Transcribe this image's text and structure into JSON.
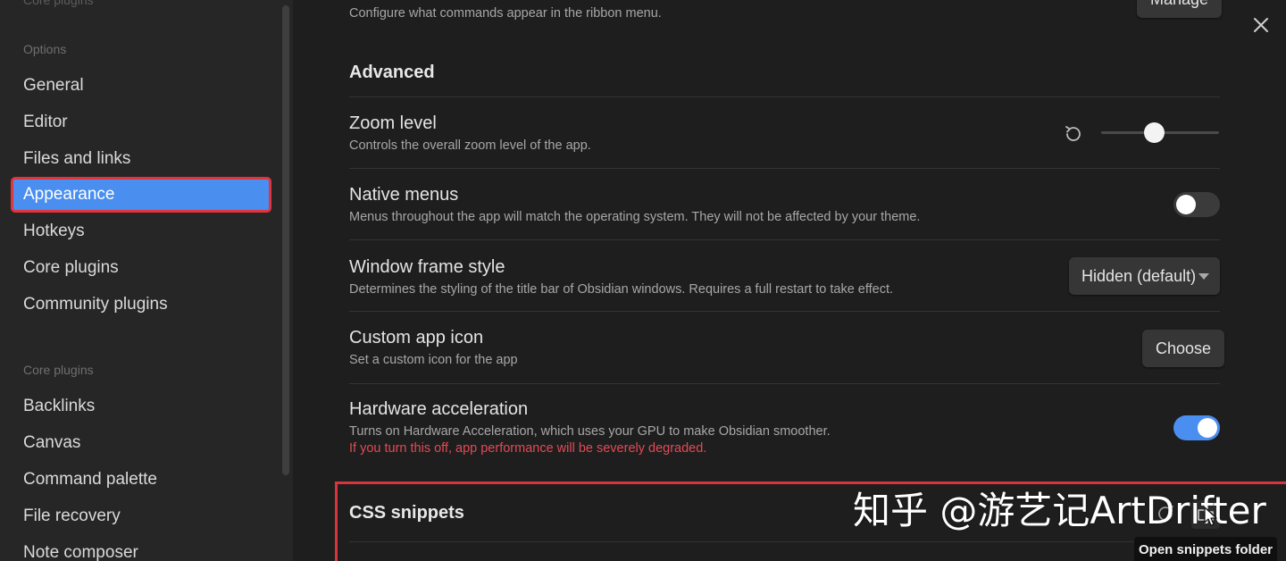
{
  "sidebar": {
    "top_cut_text": "Core plugins",
    "options_heading": "Options",
    "options_items": [
      {
        "label": "General"
      },
      {
        "label": "Editor"
      },
      {
        "label": "Files and links"
      },
      {
        "label": "Appearance"
      },
      {
        "label": "Hotkeys"
      },
      {
        "label": "Core plugins"
      },
      {
        "label": "Community plugins"
      }
    ],
    "core_plugins_heading": "Core plugins",
    "core_plugins_items": [
      {
        "label": "Backlinks"
      },
      {
        "label": "Canvas"
      },
      {
        "label": "Command palette"
      },
      {
        "label": "File recovery"
      },
      {
        "label": "Note composer"
      }
    ],
    "active_item": "Appearance"
  },
  "main": {
    "ribbon": {
      "desc": "Configure what commands appear in the ribbon menu.",
      "button_label": "Manage"
    },
    "advanced_title": "Advanced",
    "zoom": {
      "name": "Zoom level",
      "desc": "Controls the overall zoom level of the app.",
      "value_fraction": 0.45
    },
    "native_menus": {
      "name": "Native menus",
      "desc": "Menus throughout the app will match the operating system. They will not be affected by your theme.",
      "enabled": false
    },
    "window_frame": {
      "name": "Window frame style",
      "desc": "Determines the styling of the title bar of Obsidian windows. Requires a full restart to take effect.",
      "selected": "Hidden (default)"
    },
    "custom_icon": {
      "name": "Custom app icon",
      "desc": "Set a custom icon for the app",
      "button_label": "Choose"
    },
    "hardware_accel": {
      "name": "Hardware acceleration",
      "desc": "Turns on Hardware Acceleration, which uses your GPU to make Obsidian smoother.",
      "warning": "If you turn this off, app performance will be severely degraded.",
      "enabled": true
    },
    "css_snippets_title": "CSS snippets",
    "tooltip": "Open snippets folder",
    "watermark": "知乎 @游艺记ArtDrifter"
  },
  "colors": {
    "accent": "#4a8ef0",
    "highlight_border": "#e0353d",
    "warning_text": "#e34a55"
  },
  "icons": [
    "close-icon",
    "reset-icon",
    "reload-icon",
    "folder-icon",
    "cursor-icon",
    "caret-down-icon"
  ]
}
